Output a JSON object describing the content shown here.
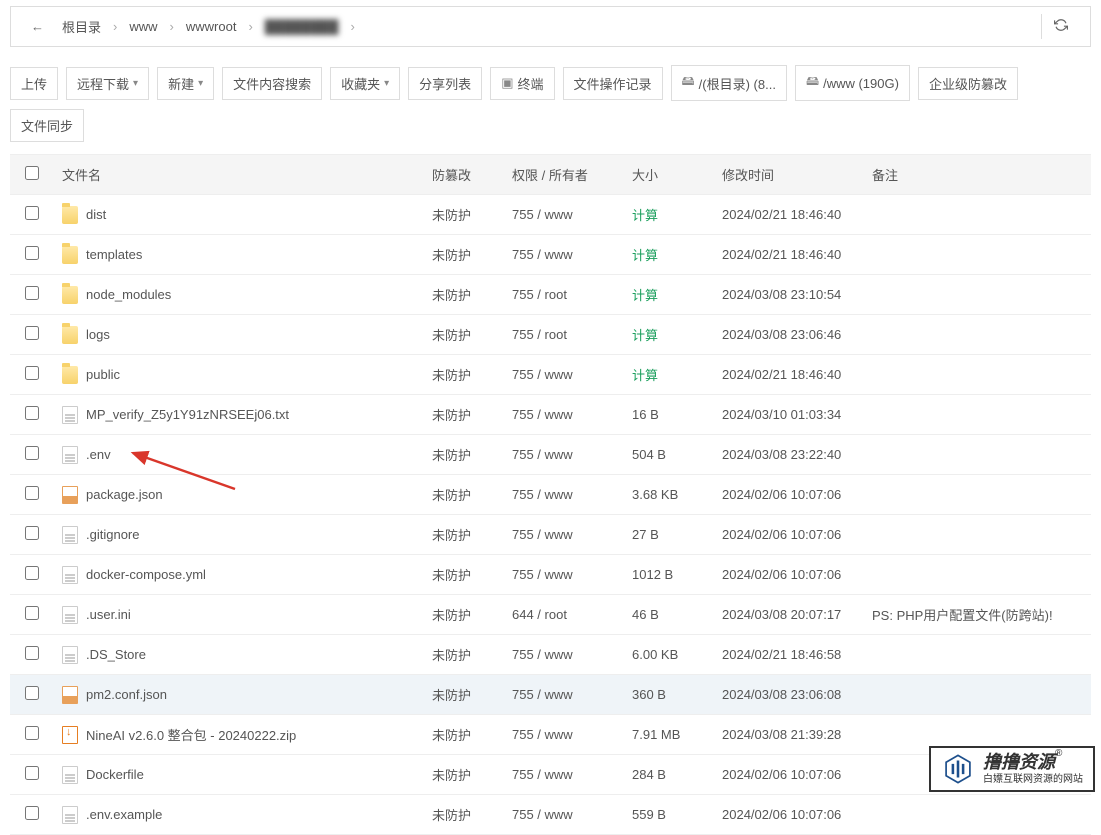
{
  "breadcrumb": {
    "back": "←",
    "items": [
      "根目录",
      "www",
      "wwwroot",
      "████████"
    ],
    "refresh": "C"
  },
  "toolbar": {
    "upload": "上传",
    "remote_dl": "远程下载",
    "new": "新建",
    "content_search": "文件内容搜索",
    "favorites": "收藏夹",
    "share_list": "分享列表",
    "terminal": "终端",
    "op_log": "文件操作记录",
    "disk_root": "/(根目录) (8...",
    "disk_www": "/www (190G)",
    "defense": "企业级防篡改",
    "sync": "文件同步"
  },
  "columns": {
    "name": "文件名",
    "prot": "防篡改",
    "perm": "权限 / 所有者",
    "size": "大小",
    "mtime": "修改时间",
    "remark": "备注"
  },
  "calc_label": "计算",
  "rows": [
    {
      "icon": "folder",
      "name": "dist",
      "prot": "未防护",
      "perm": "755 / www",
      "size": "计算",
      "mtime": "2024/02/21 18:46:40",
      "remark": ""
    },
    {
      "icon": "folder",
      "name": "templates",
      "prot": "未防护",
      "perm": "755 / www",
      "size": "计算",
      "mtime": "2024/02/21 18:46:40",
      "remark": ""
    },
    {
      "icon": "folder",
      "name": "node_modules",
      "prot": "未防护",
      "perm": "755 / root",
      "size": "计算",
      "mtime": "2024/03/08 23:10:54",
      "remark": ""
    },
    {
      "icon": "folder",
      "name": "logs",
      "prot": "未防护",
      "perm": "755 / root",
      "size": "计算",
      "mtime": "2024/03/08 23:06:46",
      "remark": ""
    },
    {
      "icon": "folder",
      "name": "public",
      "prot": "未防护",
      "perm": "755 / www",
      "size": "计算",
      "mtime": "2024/02/21 18:46:40",
      "remark": ""
    },
    {
      "icon": "file",
      "name": "MP_verify_Z5y1Y91zNRSEEj06.txt",
      "prot": "未防护",
      "perm": "755 / www",
      "size": "16 B",
      "mtime": "2024/03/10 01:03:34",
      "remark": ""
    },
    {
      "icon": "file",
      "name": ".env",
      "prot": "未防护",
      "perm": "755 / www",
      "size": "504 B",
      "mtime": "2024/03/08 23:22:40",
      "remark": "",
      "arrow": true
    },
    {
      "icon": "json",
      "name": "package.json",
      "prot": "未防护",
      "perm": "755 / www",
      "size": "3.68 KB",
      "mtime": "2024/02/06 10:07:06",
      "remark": ""
    },
    {
      "icon": "file",
      "name": ".gitignore",
      "prot": "未防护",
      "perm": "755 / www",
      "size": "27 B",
      "mtime": "2024/02/06 10:07:06",
      "remark": ""
    },
    {
      "icon": "file",
      "name": "docker-compose.yml",
      "prot": "未防护",
      "perm": "755 / www",
      "size": "1012 B",
      "mtime": "2024/02/06 10:07:06",
      "remark": ""
    },
    {
      "icon": "file",
      "name": ".user.ini",
      "prot": "未防护",
      "perm": "644 / root",
      "size": "46 B",
      "mtime": "2024/03/08 20:07:17",
      "remark": "PS: PHP用户配置文件(防跨站)!"
    },
    {
      "icon": "file",
      "name": ".DS_Store",
      "prot": "未防护",
      "perm": "755 / www",
      "size": "6.00 KB",
      "mtime": "2024/02/21 18:46:58",
      "remark": ""
    },
    {
      "icon": "json",
      "name": "pm2.conf.json",
      "prot": "未防护",
      "perm": "755 / www",
      "size": "360 B",
      "mtime": "2024/03/08 23:06:08",
      "remark": "",
      "highlight": true
    },
    {
      "icon": "zip",
      "name": "NineAI v2.6.0 整合包 - 20240222.zip",
      "prot": "未防护",
      "perm": "755 / www",
      "size": "7.91 MB",
      "mtime": "2024/03/08 21:39:28",
      "remark": ""
    },
    {
      "icon": "file",
      "name": "Dockerfile",
      "prot": "未防护",
      "perm": "755 / www",
      "size": "284 B",
      "mtime": "2024/02/06 10:07:06",
      "remark": ""
    },
    {
      "icon": "file",
      "name": ".env.example",
      "prot": "未防护",
      "perm": "755 / www",
      "size": "559 B",
      "mtime": "2024/02/06 10:07:06",
      "remark": ""
    }
  ],
  "watermark": {
    "title": "撸撸资源",
    "sub": "白嫖互联网资源的网站",
    "r": "®"
  }
}
